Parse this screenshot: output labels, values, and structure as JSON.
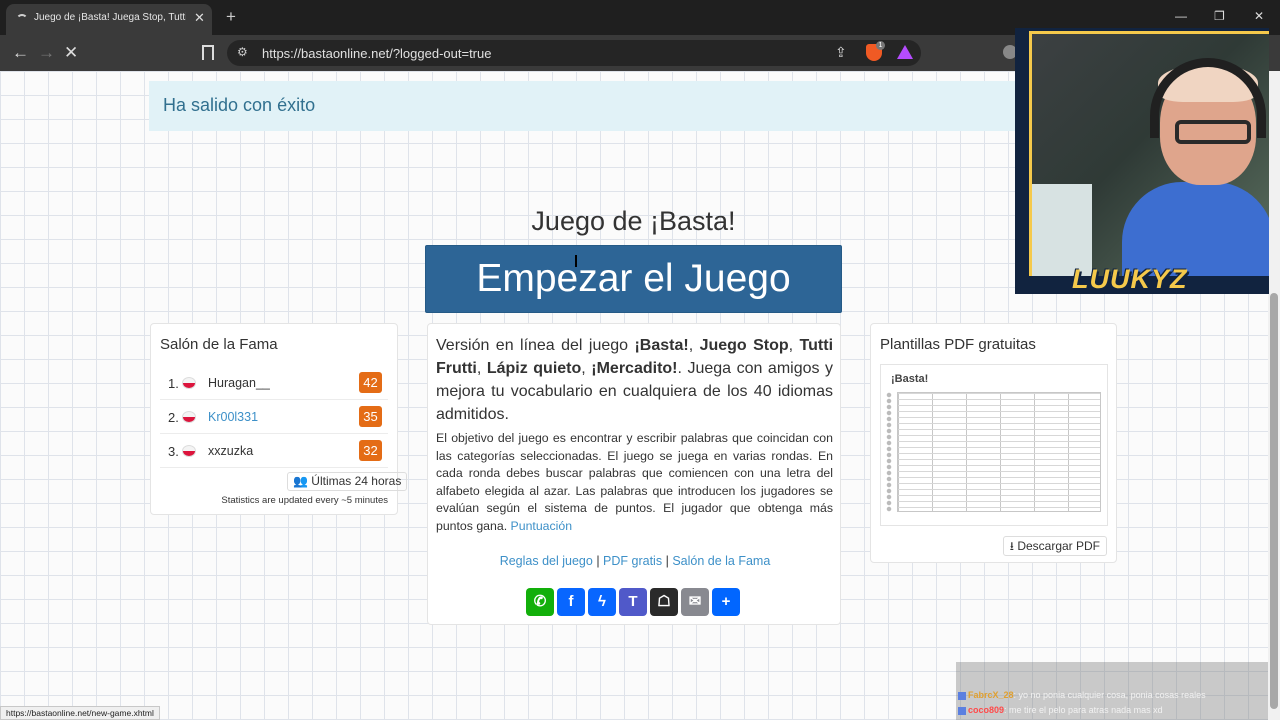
{
  "browser": {
    "tab_title": "Juego de ¡Basta! Juega Stop, Tutti Frutti - O",
    "tab_close": "✕",
    "new_tab": "+",
    "minimize": "—",
    "maximize": "❐",
    "close": "✕",
    "back": "←",
    "forward": "→",
    "stop": "✕",
    "url": "https://bastaonline.net/?logged-out=true",
    "brave_badge": "1",
    "status_url": "https://bastaonline.net/new-game.xhtml"
  },
  "page": {
    "alert": "Ha salido con éxito",
    "title": "Juego de ¡Basta!",
    "start_button": "Empezar el Juego"
  },
  "hall_of_fame": {
    "title": "Salón de la Fama",
    "entries": [
      {
        "rank": "1.",
        "name": "Huragan__",
        "score": "42",
        "linked": false
      },
      {
        "rank": "2.",
        "name": "Kr00l331",
        "score": "35",
        "linked": true
      },
      {
        "rank": "3.",
        "name": "xxzuzka",
        "score": "32",
        "linked": false
      }
    ],
    "last24_button": "Últimas 24 horas",
    "stats_note": "Statistics are updated every ~5 minutes"
  },
  "info": {
    "lead": {
      "t1": "Versión en línea del juego ",
      "b1": "¡Basta!",
      "t2": ", ",
      "b2": "Juego Stop",
      "t3": ", ",
      "b3": "Tutti Frutti",
      "t4": ", ",
      "b4": "Lápiz quieto",
      "t5": ", ",
      "b5": "¡Mercadito!",
      "t6": ". Juega con amigos y mejora tu vocabulario en cualquiera de los 40 idiomas admitidos."
    },
    "body": "El objetivo del juego es encontrar y escribir palabras que coincidan con las categorías seleccionadas. El juego se juega en varias rondas. En cada ronda debes buscar palabras que comiencen con una letra del alfabeto elegida al azar. Las palabras que introducen los jugadores se evalúan según el sistema de puntos. El jugador que obtenga más puntos gana.",
    "score_link": "Puntuación",
    "links": [
      "Reglas del juego",
      "PDF gratis",
      "Salón de la Fama"
    ],
    "separator": "|",
    "share_buttons": [
      {
        "name": "WhatsApp",
        "glyph": "✆",
        "color": "#12af0a"
      },
      {
        "name": "Facebook",
        "glyph": "f",
        "color": "#0866ff"
      },
      {
        "name": "Messenger",
        "glyph": "ϟ",
        "color": "#0866ff"
      },
      {
        "name": "Teams",
        "glyph": "T",
        "color": "#5059c9"
      },
      {
        "name": "Snapchat",
        "glyph": "☖",
        "color": "#2a2a2a"
      },
      {
        "name": "Email",
        "glyph": "✉",
        "color": "#888990"
      },
      {
        "name": "Share",
        "glyph": "+",
        "color": "#0166ff"
      }
    ]
  },
  "pdf": {
    "title": "Plantillas PDF gratuitas",
    "preview_logo": "¡Basta!",
    "download_button": "Descargar PDF"
  },
  "stream": {
    "streamer_name": "LUUKYZ",
    "chat": [
      {
        "user": "FabrcX_28",
        "color": "#e0a030",
        "msg": ": yo no ponia cualquier cosa, ponia cosas reales"
      },
      {
        "user": "coco809",
        "color": "#ff4a4a",
        "msg": ": me tire el pelo para atras nada mas xd"
      }
    ]
  },
  "colors": {
    "primary_button": "#2d6596",
    "score_badge": "#e46c16",
    "link": "#3d90c8",
    "alert_bg": "#e1f2f7",
    "alert_text": "#31708f"
  }
}
